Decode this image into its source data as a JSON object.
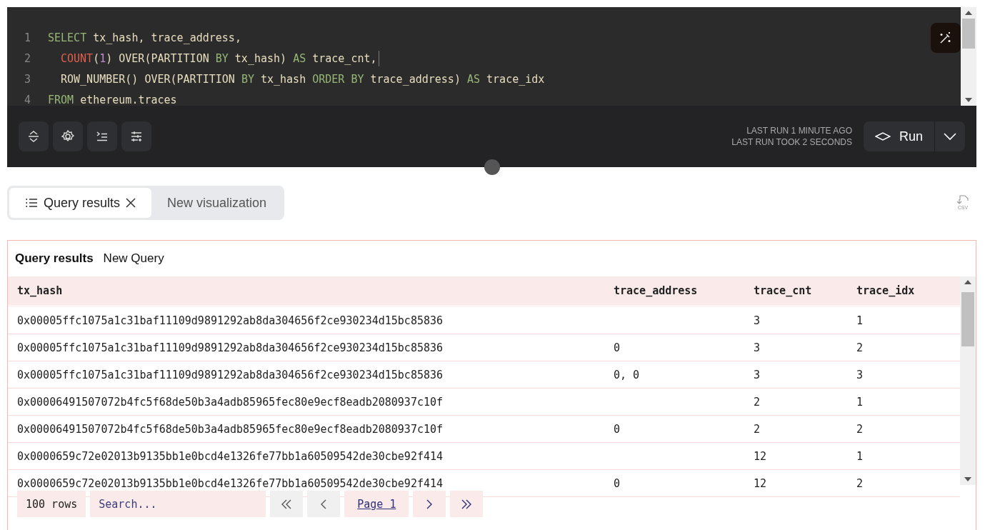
{
  "editor": {
    "lines": [
      {
        "number": "1",
        "cursor": false,
        "indented": false,
        "tokens": [
          {
            "text": "SELECT",
            "kind": "keyword"
          },
          {
            "text": " tx_hash, trace_address,",
            "kind": "plain"
          }
        ]
      },
      {
        "number": "2",
        "cursor": true,
        "indented": true,
        "tokens": [
          {
            "text": "COUNT",
            "kind": "function"
          },
          {
            "text": "(",
            "kind": "plain"
          },
          {
            "text": "1",
            "kind": "number"
          },
          {
            "text": ") OVER(PARTITION ",
            "kind": "plain"
          },
          {
            "text": "BY",
            "kind": "keyword"
          },
          {
            "text": " tx_hash) ",
            "kind": "plain"
          },
          {
            "text": "AS",
            "kind": "keyword"
          },
          {
            "text": " trace_cnt,",
            "kind": "plain"
          }
        ]
      },
      {
        "number": "3",
        "cursor": false,
        "indented": true,
        "tokens": [
          {
            "text": "ROW_NUMBER() OVER(PARTITION ",
            "kind": "plain"
          },
          {
            "text": "BY",
            "kind": "keyword"
          },
          {
            "text": " tx_hash ",
            "kind": "plain"
          },
          {
            "text": "ORDER BY",
            "kind": "keyword"
          },
          {
            "text": " trace_address) ",
            "kind": "plain"
          },
          {
            "text": "AS",
            "kind": "keyword"
          },
          {
            "text": " trace_idx",
            "kind": "plain"
          }
        ]
      },
      {
        "number": "4",
        "cursor": false,
        "indented": false,
        "tokens": [
          {
            "text": "FROM",
            "kind": "keyword"
          },
          {
            "text": " ethereum.traces",
            "kind": "plain"
          }
        ]
      }
    ],
    "tools": [
      {
        "kind": "expand"
      },
      {
        "kind": "settings"
      },
      {
        "kind": "indent"
      },
      {
        "kind": "sliders"
      }
    ],
    "last_run": "LAST RUN 1 MINUTE AGO",
    "last_run_took": "LAST RUN TOOK 2 SECONDS",
    "run_button": "Run"
  },
  "tabs": [
    {
      "label": "Query results",
      "kind": "table",
      "closable": true,
      "selected": true
    },
    {
      "label": "New visualization",
      "kind": "new",
      "closable": false,
      "selected": false
    }
  ],
  "csv_label": "CSV",
  "results": {
    "title": "Query results",
    "subtitle": "New Query",
    "columns": [
      "tx_hash",
      "trace_address",
      "trace_cnt",
      "trace_idx"
    ],
    "rows": [
      [
        "0x00005ffc1075a1c31baf11109d9891292ab8da304656f2ce930234d15bc85836",
        "",
        "3",
        "1"
      ],
      [
        "0x00005ffc1075a1c31baf11109d9891292ab8da304656f2ce930234d15bc85836",
        "0",
        "3",
        "2"
      ],
      [
        "0x00005ffc1075a1c31baf11109d9891292ab8da304656f2ce930234d15bc85836",
        "0, 0",
        "3",
        "3"
      ],
      [
        "0x00006491507072b4fc5f68de50b3a4adb85965fec80e9ecf8eadb2080937c10f",
        "",
        "2",
        "1"
      ],
      [
        "0x00006491507072b4fc5f68de50b3a4adb85965fec80e9ecf8eadb2080937c10f",
        "0",
        "2",
        "2"
      ],
      [
        "0x0000659c72e02013b9135bb1e0bcd4e1326fe77bb1a60509542de30cbe92f414",
        "",
        "12",
        "1"
      ],
      [
        "0x0000659c72e02013b9135bb1e0bcd4e1326fe77bb1a60509542de30cbe92f414",
        "0",
        "12",
        "2"
      ]
    ],
    "row_count": "100 rows",
    "search": {
      "placeholder": "Search..."
    },
    "pager": [
      {
        "kind": "first",
        "disabled": true
      },
      {
        "kind": "prev",
        "disabled": true
      },
      {
        "kind": "page",
        "label": "Page 1",
        "disabled": false
      },
      {
        "kind": "next",
        "disabled": false
      },
      {
        "kind": "last",
        "disabled": false
      }
    ]
  }
}
